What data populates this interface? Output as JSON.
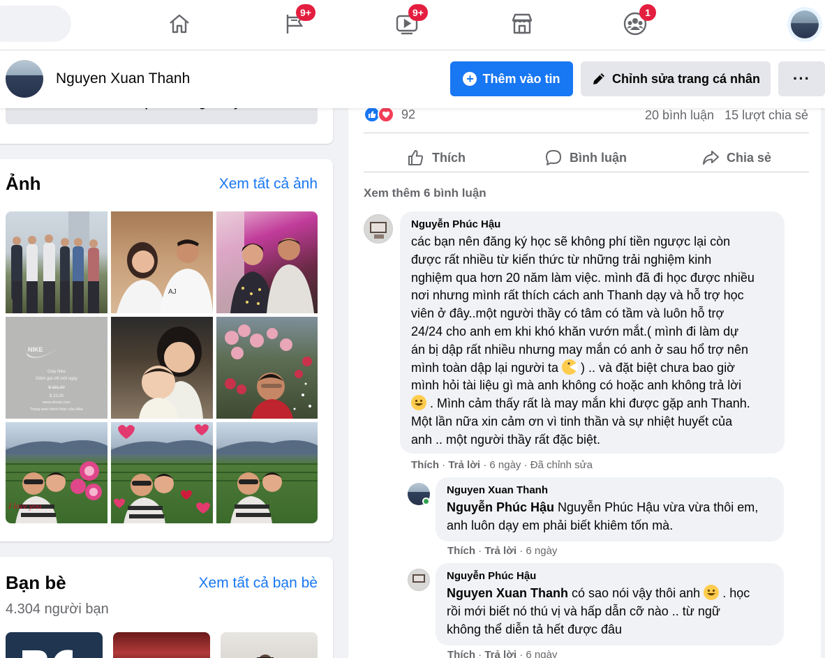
{
  "nav": {
    "icons": [
      "home-icon",
      "flag-icon",
      "watch-icon",
      "marketplace-icon",
      "groups-icon"
    ],
    "badges": {
      "pages": "9+",
      "watch": "9+",
      "groups": "1"
    }
  },
  "profile_bar": {
    "name": "Nguyen Xuan Thanh",
    "add_story": "Thêm vào tin",
    "edit_profile": "Chỉnh sửa trang cá nhân",
    "more": "···"
  },
  "left": {
    "featured_button": "Chỉnh sửa phần Đáng chú ý",
    "photos_title": "Ảnh",
    "photos_link": "Xem tất cả ảnh",
    "friends_title": "Bạn bè",
    "friends_link": "Xem tất cả bạn bè",
    "friends_count": "4.304 người bạn",
    "photo_texts": {
      "brand": "NIKE",
      "line1": "Giày Nike",
      "line2": "Giảm giá chỉ một ngày",
      "old_price": "$ 181.00",
      "price": "$ 23.00",
      "site": "www.nkzao.com",
      "site_desc": "Trang web chính thức của Nike",
      "love": "I love you"
    }
  },
  "post": {
    "reaction_count": "92",
    "comments_count": "20 bình luận",
    "shares_count": "15 lượt chia sẻ",
    "like": "Thích",
    "comment": "Bình luận",
    "share": "Chia sẻ",
    "see_more": "Xem thêm 6 bình luận",
    "colors": {
      "accent": "#1877f2",
      "love": "#f33e58",
      "online": "#31a24c"
    }
  },
  "comments": [
    {
      "author": "Nguyễn Phúc Hậu",
      "lines": [
        "các bạn nên đăng ký học sẽ không phí tiền ngược lại còn",
        "được rất nhiều từ kiến thức từ những trải nghiệm kinh",
        "nghiệm qua hơn 20 năm làm việc. mình đã đi học được nhiều",
        "nơi nhưng mình rất thích cách anh Thanh dạy và hỗ trợ học",
        "viên ở đây..một người thầy có tâm có tầm và luôn hỗ trợ",
        "24/24 cho anh em khi khó khăn vướn mắt.( mình đi làm dự",
        "án bị dập rất nhiều nhưng may mắn có anh ở sau hổ trợ nên",
        "mình toàn dập lại người ta",
        ") .. và đặt biệt chưa bao giờ",
        "mình hỏi tài liệu gì mà anh không có hoặc anh không trả lời",
        ". Mình cảm thấy rất là may mắn khi được gặp anh Thanh.",
        "Một lần nữa xin cảm ơn vì tinh thần và sự nhiệt huyết của",
        "anh .. một người thầy rất đặc biệt."
      ],
      "like": "Thích",
      "reply": "Trả lời",
      "time": "6 ngày",
      "edited": "Đã chỉnh sửa",
      "sep": "·"
    },
    {
      "author": "Nguyen Xuan Thanh",
      "mention": "Nguyễn Phúc Hậu",
      "lines": [
        "Nguyễn Phúc Hậu vừa vừa thôi em,",
        "anh luôn dạy em phải biết khiêm tốn mà."
      ],
      "like": "Thích",
      "reply": "Trả lời",
      "time": "6 ngày",
      "sep": "·"
    },
    {
      "author": "Nguyễn Phúc Hậu",
      "mention": "Nguyen Xuan Thanh",
      "lines": [
        "có sao nói vậy thôi anh",
        ". học",
        "rồi mới biết nó thú vị và hấp dẫn cỡ nào .. từ ngữ",
        "không thể diễn tả hết được đâu"
      ],
      "like": "Thích",
      "reply": "Trả lời",
      "time": "6 ngày",
      "sep": "·"
    }
  ]
}
